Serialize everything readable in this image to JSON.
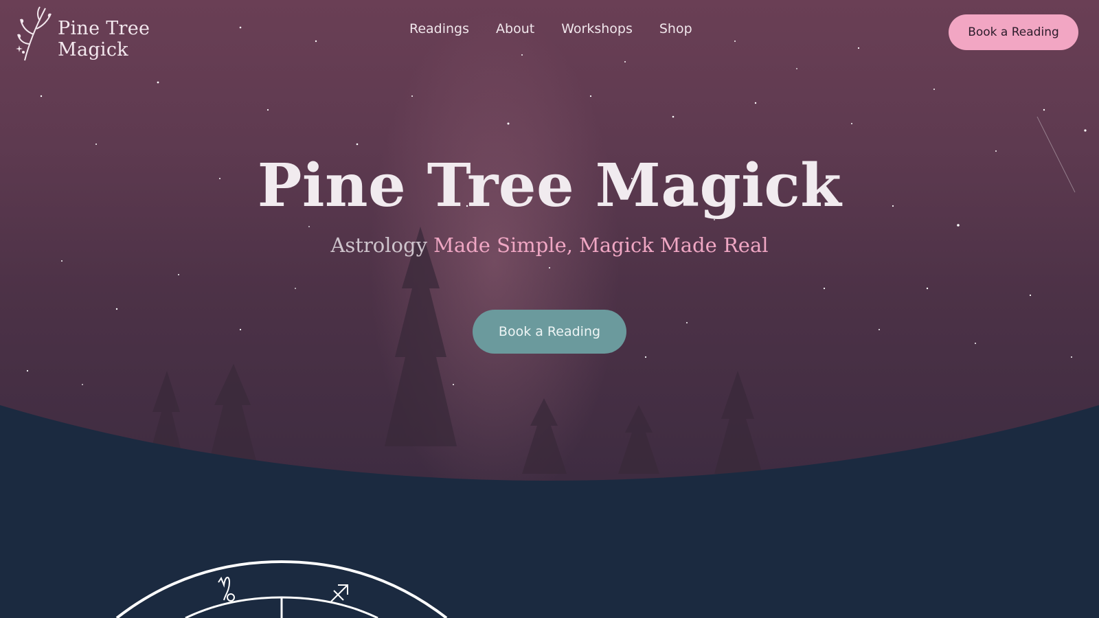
{
  "brand": {
    "name": "Pine Tree Magick"
  },
  "nav": {
    "items": [
      {
        "label": "Readings"
      },
      {
        "label": "About"
      },
      {
        "label": "Workshops"
      },
      {
        "label": "Shop"
      }
    ],
    "cta_label": "Book a Reading"
  },
  "hero": {
    "title": "Pine Tree Magick",
    "subtitle_plain": "Astrology",
    "subtitle_accent": "Made Simple, Magick Made Real",
    "cta_label": "Book a Reading"
  },
  "colors": {
    "accent_pink": "#f2a6c3",
    "teal": "#6b9a9d",
    "navy": "#1b2a40",
    "plum": "#5e3a50"
  },
  "icons": {
    "logo": "botanical-sprig-icon",
    "zodiac": [
      "capricorn-glyph",
      "sagittarius-glyph"
    ]
  }
}
